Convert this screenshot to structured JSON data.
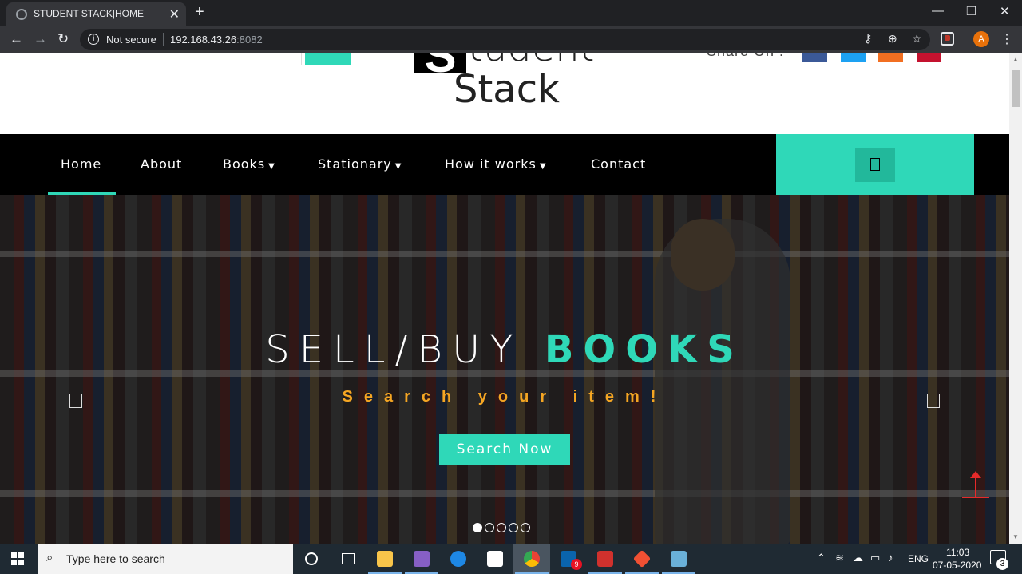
{
  "browser": {
    "tab_title": "STUDENT STACK|HOME",
    "not_secure_label": "Not secure",
    "url_host": "192.168.43.26",
    "url_port": ":8082",
    "profile_initial": "A"
  },
  "header": {
    "logo_letter": "S",
    "logo_rest": "tudent",
    "logo_line2": "Stack",
    "share_label": "Share On :",
    "social_colors": [
      "#3b5998",
      "#1da1f2",
      "#f26f21",
      "#c4122f"
    ]
  },
  "nav": {
    "items": [
      {
        "label": "Home",
        "caret": false
      },
      {
        "label": "About",
        "caret": false
      },
      {
        "label": "Books",
        "caret": true
      },
      {
        "label": "Stationary",
        "caret": true
      },
      {
        "label": "How it works",
        "caret": true
      },
      {
        "label": "Contact",
        "caret": false
      }
    ],
    "active_index": 0
  },
  "hero": {
    "title_plain": "SELL/BUY ",
    "title_accent": "BOOKS",
    "subtitle": "Search your item!",
    "cta_label": "Search Now",
    "slide_count": 5,
    "active_slide": 1
  },
  "taskbar": {
    "search_placeholder": "Type here to search",
    "language": "ENG",
    "time": "11:03",
    "date": "07-05-2020",
    "outlook_badge": "9",
    "notification_count": "3"
  },
  "colors": {
    "accent": "#2fd8b8",
    "subtitle": "#f5a623",
    "nav_bg": "#000000"
  }
}
